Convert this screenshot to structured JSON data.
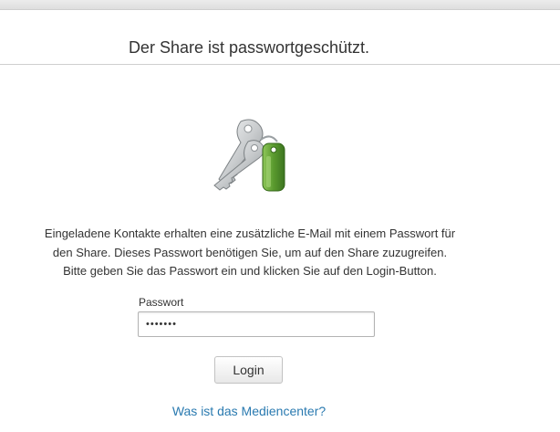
{
  "page": {
    "title": "Der Share ist passwortgeschützt.",
    "icon": "keys-icon",
    "description_lines": [
      "Eingeladene Kontakte erhalten eine zusätzliche E-Mail mit einem Passwort für",
      "den Share. Dieses Passwort benötigen Sie, um auf den Share zuzugreifen.",
      "Bitte geben Sie das Passwort ein und klicken Sie auf den Login-Button."
    ]
  },
  "form": {
    "password_label": "Passwort",
    "password_value": "•••••••",
    "login_label": "Login"
  },
  "help": {
    "link_text": "Was ist das Mediencenter?"
  },
  "colors": {
    "link": "#2a7ab0",
    "tag_green": "#5a9a2e",
    "key_silver": "#c9ccce"
  }
}
